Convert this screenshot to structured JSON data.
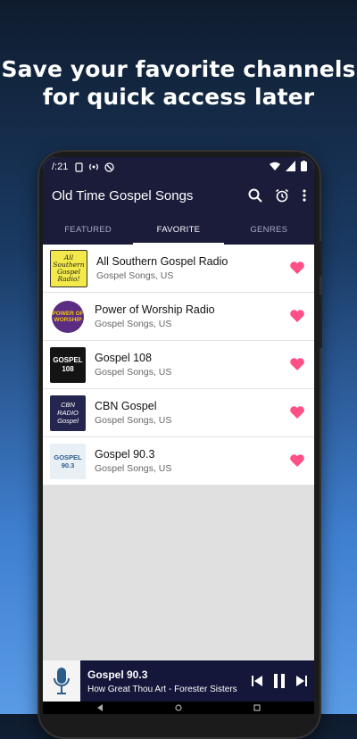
{
  "headline": {
    "line1": "Save your favorite channels",
    "line2": "for quick access later"
  },
  "status": {
    "time": "/:21"
  },
  "app": {
    "title": "Old Time Gospel Songs"
  },
  "tabs": [
    {
      "label": "FEATURED"
    },
    {
      "label": "FAVORITE"
    },
    {
      "label": "GENRES"
    }
  ],
  "stations": [
    {
      "title": "All Southern Gospel Radio",
      "subtitle": "Gospel Songs, US",
      "logo_text": "All Southern Gospel Radio!"
    },
    {
      "title": "Power of Worship Radio",
      "subtitle": "Gospel Songs, US",
      "logo_text": "POWER OF WORSHIP"
    },
    {
      "title": "Gospel 108",
      "subtitle": "Gospel Songs, US",
      "logo_text": "GOSPEL 108"
    },
    {
      "title": "CBN Gospel",
      "subtitle": "Gospel Songs, US",
      "logo_text": "CBN RADIO Gospel"
    },
    {
      "title": "Gospel 90.3",
      "subtitle": "Gospel Songs, US",
      "logo_text": "GOSPEL 90.3"
    }
  ],
  "player": {
    "title": "Gospel 90.3",
    "subtitle": "How Great Thou Art - Forester Sisters"
  },
  "colors": {
    "accent": "#ff4f87",
    "appbar": "#1a1c3a"
  }
}
